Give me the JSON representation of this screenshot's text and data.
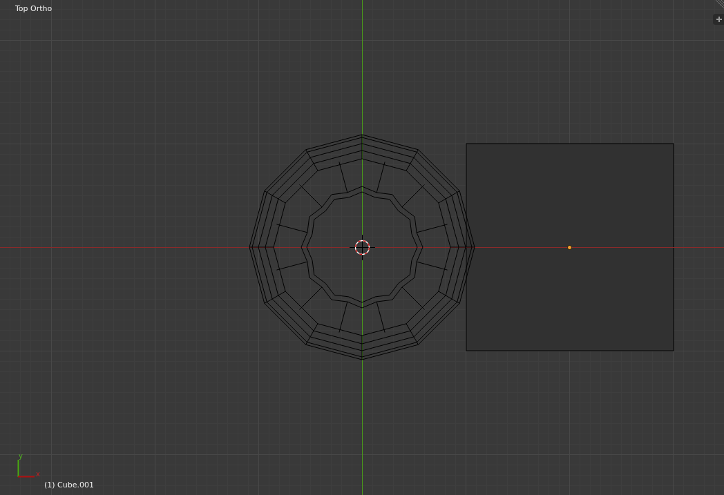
{
  "viewport": {
    "view_name": "Top Ortho",
    "object_info": "(1) Cube.001",
    "axis_labels": [
      {
        "kind": "y",
        "text": "y"
      },
      {
        "kind": "x",
        "text": "x"
      }
    ]
  }
}
